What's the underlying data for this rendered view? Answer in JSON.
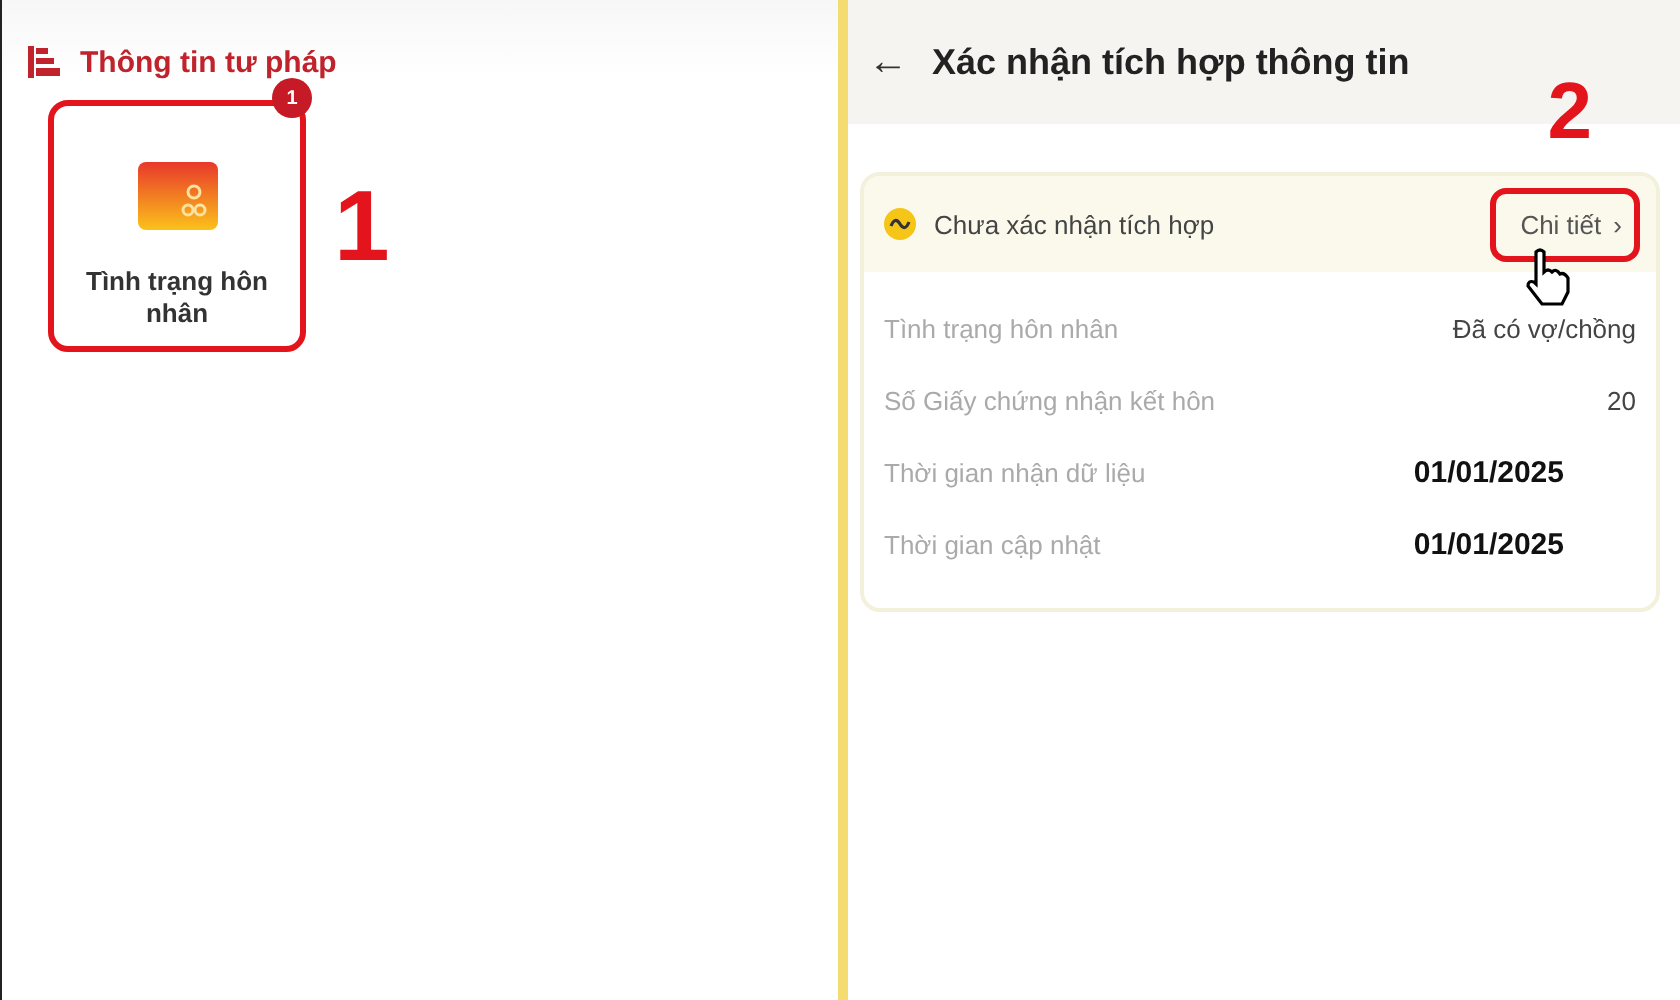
{
  "left_panel": {
    "section_title": "Thông tin tư pháp",
    "tile": {
      "label": "Tình trạng hôn nhân",
      "badge": "1"
    },
    "step_label": "1"
  },
  "right_panel": {
    "back_icon": "←",
    "title": "Xác nhận tích hợp thông tin",
    "step_label": "2",
    "status": {
      "label": "Chưa xác nhận tích hợp",
      "link": "Chi tiết",
      "chevron": "›"
    },
    "fields": [
      {
        "label": "Tình trạng hôn nhân",
        "value": "Đã có vợ/chồng",
        "kind": "plain"
      },
      {
        "label": "Số Giấy chứng nhận kết hôn",
        "value": "20",
        "kind": "plain"
      },
      {
        "label": "Thời gian nhận dữ liệu",
        "value": "01/01/2025",
        "kind": "bold"
      },
      {
        "label": "Thời gian cập nhật",
        "value": "01/01/2025",
        "kind": "bold"
      }
    ]
  }
}
